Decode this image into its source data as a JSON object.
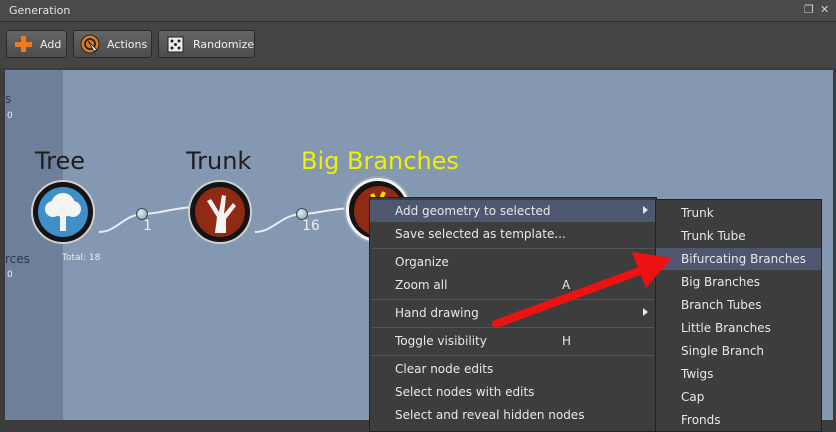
{
  "window": {
    "title": "Generation"
  },
  "toolbar": {
    "add_label": "Add",
    "actions_label": "Actions",
    "randomize_label": "Randomize"
  },
  "left_partial": {
    "top_text": "s",
    "top_value": "0",
    "bottom_text": "rces",
    "bottom_value": "0"
  },
  "graph": {
    "nodes": [
      {
        "name": "Tree",
        "selected": false
      },
      {
        "name": "Trunk",
        "selected": false
      },
      {
        "name": "Big Branches",
        "selected": true
      }
    ],
    "link_counts": [
      "1",
      "16"
    ],
    "total_label": "Total: 18"
  },
  "context_menu": {
    "items": [
      {
        "label": "Add geometry to selected",
        "shortcut": "",
        "submenu": true,
        "highlighted": true
      },
      {
        "label": "Save selected as template...",
        "shortcut": "",
        "submenu": false
      },
      {
        "label": "Organize",
        "shortcut": "",
        "submenu": true
      },
      {
        "label": "Zoom all",
        "shortcut": "A",
        "submenu": false
      },
      {
        "label": "Hand drawing",
        "shortcut": "",
        "submenu": true
      },
      {
        "label": "Toggle visibility",
        "shortcut": "H",
        "submenu": false
      },
      {
        "label": "Clear node edits",
        "shortcut": "",
        "submenu": false
      },
      {
        "label": "Select nodes with edits",
        "shortcut": "",
        "submenu": false
      },
      {
        "label": "Select and reveal hidden nodes",
        "shortcut": "",
        "submenu": false
      }
    ]
  },
  "submenu": {
    "items": [
      {
        "label": "Trunk"
      },
      {
        "label": "Trunk Tube"
      },
      {
        "label": "Bifurcating Branches",
        "highlighted": true
      },
      {
        "label": "Big Branches"
      },
      {
        "label": "Branch Tubes"
      },
      {
        "label": "Little Branches"
      },
      {
        "label": "Single Branch"
      },
      {
        "label": "Twigs"
      },
      {
        "label": "Cap"
      },
      {
        "label": "Fronds"
      }
    ]
  },
  "colors": {
    "canvas": "#8598b1",
    "menu_bg": "#3d3d3d",
    "menu_highlight": "#4e5770",
    "selected_node_label": "#f0f000",
    "annotation_arrow": "#ee1111"
  }
}
